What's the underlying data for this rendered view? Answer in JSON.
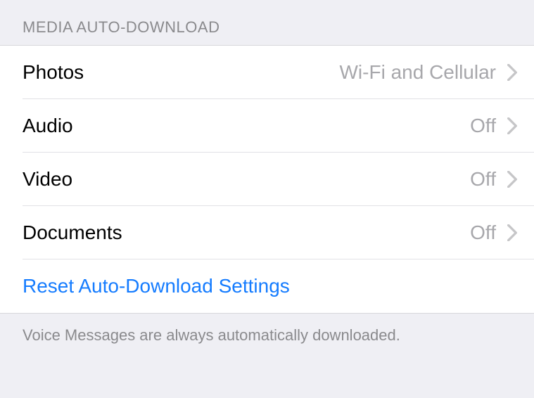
{
  "section": {
    "header": "MEDIA AUTO-DOWNLOAD",
    "items": [
      {
        "label": "Photos",
        "value": "Wi-Fi and Cellular"
      },
      {
        "label": "Audio",
        "value": "Off"
      },
      {
        "label": "Video",
        "value": "Off"
      },
      {
        "label": "Documents",
        "value": "Off"
      }
    ],
    "reset_label": "Reset Auto-Download Settings",
    "footer": "Voice Messages are always automatically downloaded."
  }
}
